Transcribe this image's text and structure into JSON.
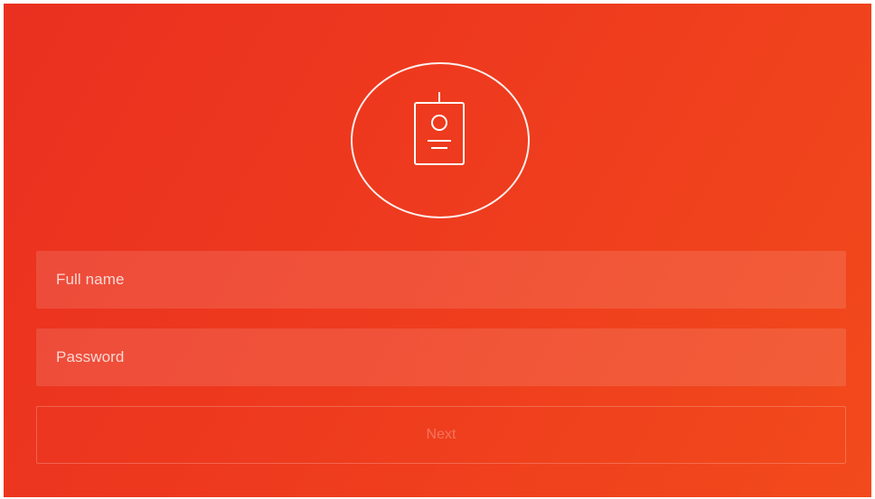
{
  "form": {
    "icon": "id-badge-icon",
    "full_name_placeholder": "Full name",
    "password_placeholder": "Password",
    "next_label": "Next"
  },
  "colors": {
    "background_start": "#ea3020",
    "background_end": "#f24a1c",
    "foreground": "#ffffff"
  }
}
